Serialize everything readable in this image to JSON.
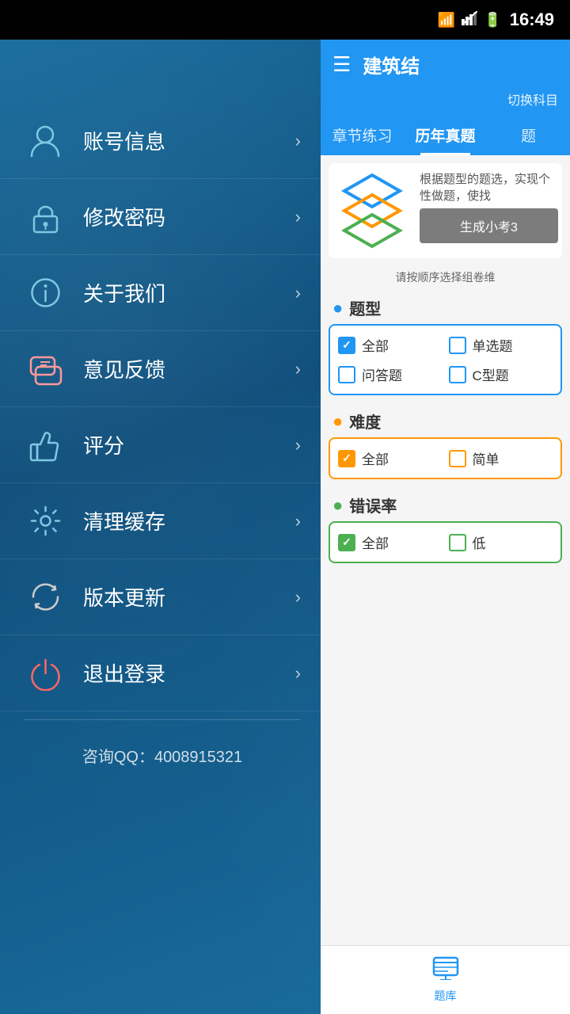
{
  "statusBar": {
    "time": "16:49"
  },
  "sidebar": {
    "menuItems": [
      {
        "id": "account",
        "label": "账号信息",
        "iconType": "person"
      },
      {
        "id": "password",
        "label": "修改密码",
        "iconType": "lock"
      },
      {
        "id": "about",
        "label": "关于我们",
        "iconType": "info"
      },
      {
        "id": "feedback",
        "label": "意见反馈",
        "iconType": "chat"
      },
      {
        "id": "rating",
        "label": "评分",
        "iconType": "thumbup"
      },
      {
        "id": "cache",
        "label": "清理缓存",
        "iconType": "gear"
      },
      {
        "id": "update",
        "label": "版本更新",
        "iconType": "refresh"
      },
      {
        "id": "logout",
        "label": "退出登录",
        "iconType": "power"
      }
    ],
    "contact": "咨询QQ：4008915321"
  },
  "rightPanel": {
    "header": {
      "title": "建筑结",
      "subtitle": "切换科目",
      "hamburgerLabel": "☰"
    },
    "tabs": [
      {
        "id": "chapter",
        "label": "章节练习",
        "active": false
      },
      {
        "id": "past",
        "label": "历年真题",
        "active": true
      },
      {
        "id": "more",
        "label": "题"
      }
    ],
    "logoDesc": "根据题型的题选，实现个性做题，使找",
    "generateBtn": "生成小考3",
    "tipText": "请按顺序选择组卷维",
    "sections": [
      {
        "id": "question-type",
        "dotColor": "blue",
        "title": "题型",
        "checkboxes": [
          {
            "id": "all-type",
            "label": "全部",
            "checked": true,
            "colorClass": "checked"
          },
          {
            "id": "single",
            "label": "单选题",
            "checked": false,
            "colorClass": ""
          },
          {
            "id": "qa",
            "label": "问答题",
            "checked": false,
            "colorClass": ""
          },
          {
            "id": "ctype",
            "label": "C型题",
            "checked": false,
            "colorClass": ""
          }
        ],
        "borderClass": ""
      },
      {
        "id": "difficulty",
        "dotColor": "orange",
        "title": "难度",
        "checkboxes": [
          {
            "id": "all-diff",
            "label": "全部",
            "checked": true,
            "colorClass": "checked-orange"
          },
          {
            "id": "simple",
            "label": "简单",
            "checked": false,
            "colorClass": "unchecked-orange"
          }
        ],
        "borderClass": "orange-border"
      },
      {
        "id": "error-rate",
        "dotColor": "green",
        "title": "错误率",
        "checkboxes": [
          {
            "id": "all-err",
            "label": "全部",
            "checked": true,
            "colorClass": "checked-green"
          },
          {
            "id": "low",
            "label": "低",
            "checked": false,
            "colorClass": "unchecked-green"
          }
        ],
        "borderClass": "green-border"
      }
    ],
    "bottomNav": [
      {
        "id": "library",
        "icon": "📚",
        "label": "题库"
      }
    ]
  }
}
